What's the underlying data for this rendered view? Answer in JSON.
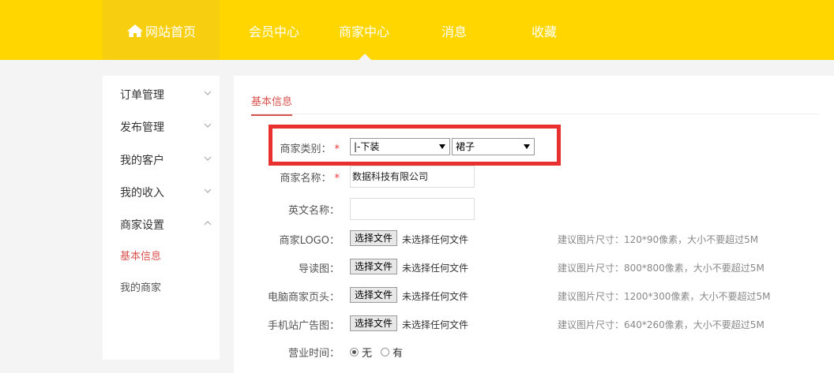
{
  "nav": {
    "home": "网站首页",
    "member": "会员中心",
    "merchant": "商家中心",
    "messages": "消息",
    "favorites": "收藏"
  },
  "sidebar": {
    "items": [
      {
        "label": "订单管理",
        "expanded": false
      },
      {
        "label": "发布管理",
        "expanded": false
      },
      {
        "label": "我的客户",
        "expanded": false
      },
      {
        "label": "我的收入",
        "expanded": false
      },
      {
        "label": "商家设置",
        "expanded": true
      }
    ],
    "subitems": [
      {
        "label": "基本信息",
        "active": true
      },
      {
        "label": "我的商家",
        "active": false
      }
    ]
  },
  "tab": {
    "label": "基本信息"
  },
  "form": {
    "category": {
      "label": "商家类别：",
      "required": "*",
      "select1": "|-下装",
      "select2": "裙子"
    },
    "name": {
      "label": "商家名称：",
      "required": "*",
      "value": "数据科技有限公司"
    },
    "english_name": {
      "label": "英文名称：",
      "value": ""
    },
    "logo": {
      "label": "商家LOGO：",
      "button": "选择文件",
      "status": "未选择任何文件",
      "hint": "建议图片尺寸：120*90像素，大小不要超过5M"
    },
    "guide": {
      "label": "导读图：",
      "button": "选择文件",
      "status": "未选择任何文件",
      "hint": "建议图片尺寸：800*800像素，大小不要超过5M"
    },
    "pc_header": {
      "label": "电脑商家页头：",
      "button": "选择文件",
      "status": "未选择任何文件",
      "hint": "建议图片尺寸：1200*300像素，大小不要超过5M"
    },
    "mobile_ad": {
      "label": "手机站广告图：",
      "button": "选择文件",
      "status": "未选择任何文件",
      "hint": "建议图片尺寸：640*260像素，大小不要超过5M"
    },
    "hours": {
      "label": "营业时间：",
      "option_none": "无",
      "option_yes": "有",
      "selected": "无"
    }
  },
  "colors": {
    "accent": "#ffd600",
    "active": "#d9534f",
    "highlight": "#e8312f"
  }
}
